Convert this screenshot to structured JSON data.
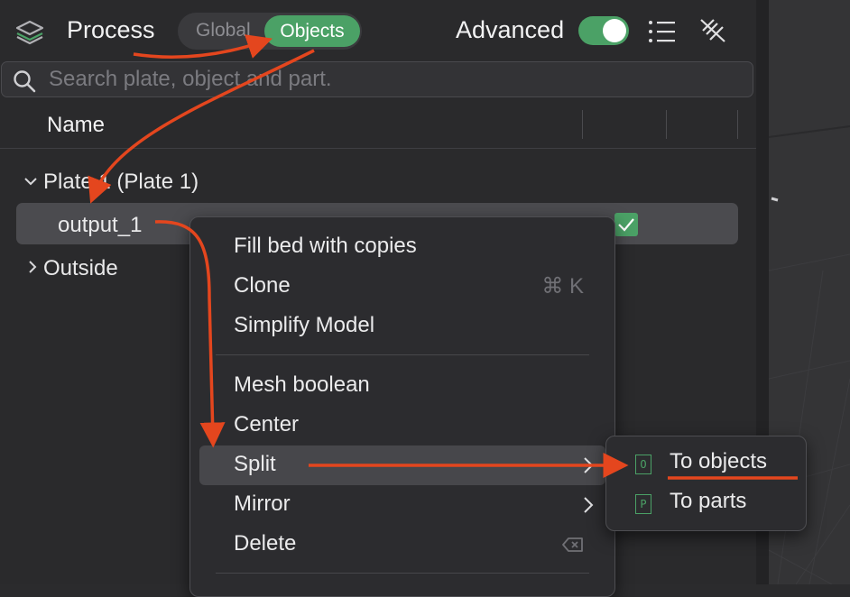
{
  "header": {
    "title": "Process",
    "segments": [
      "Global",
      "Objects"
    ],
    "active_segment": "Objects",
    "advanced_label": "Advanced",
    "advanced_on": true
  },
  "search": {
    "placeholder": "Search plate, object and part."
  },
  "columns": {
    "name": "Name"
  },
  "tree": {
    "plate_label": "Plate  1 (Plate 1)",
    "object_label": "output_1",
    "outside_label": "Outside"
  },
  "context_menu": {
    "items": [
      {
        "label": "Fill bed with copies"
      },
      {
        "label": "Clone",
        "shortcut": "⌘ K"
      },
      {
        "label": "Simplify Model"
      },
      {
        "label": "Mesh boolean"
      },
      {
        "label": "Center"
      },
      {
        "label": "Split",
        "has_submenu": true
      },
      {
        "label": "Mirror",
        "has_submenu": true
      },
      {
        "label": "Delete",
        "shortcut_icon": "delete-key-icon"
      }
    ]
  },
  "submenu": {
    "items": [
      {
        "label": "To objects",
        "icon_text": "O"
      },
      {
        "label": "To parts",
        "icon_text": "P"
      }
    ]
  },
  "colors": {
    "accent_green": "#4ba166",
    "annotation_red": "#e4461e"
  }
}
